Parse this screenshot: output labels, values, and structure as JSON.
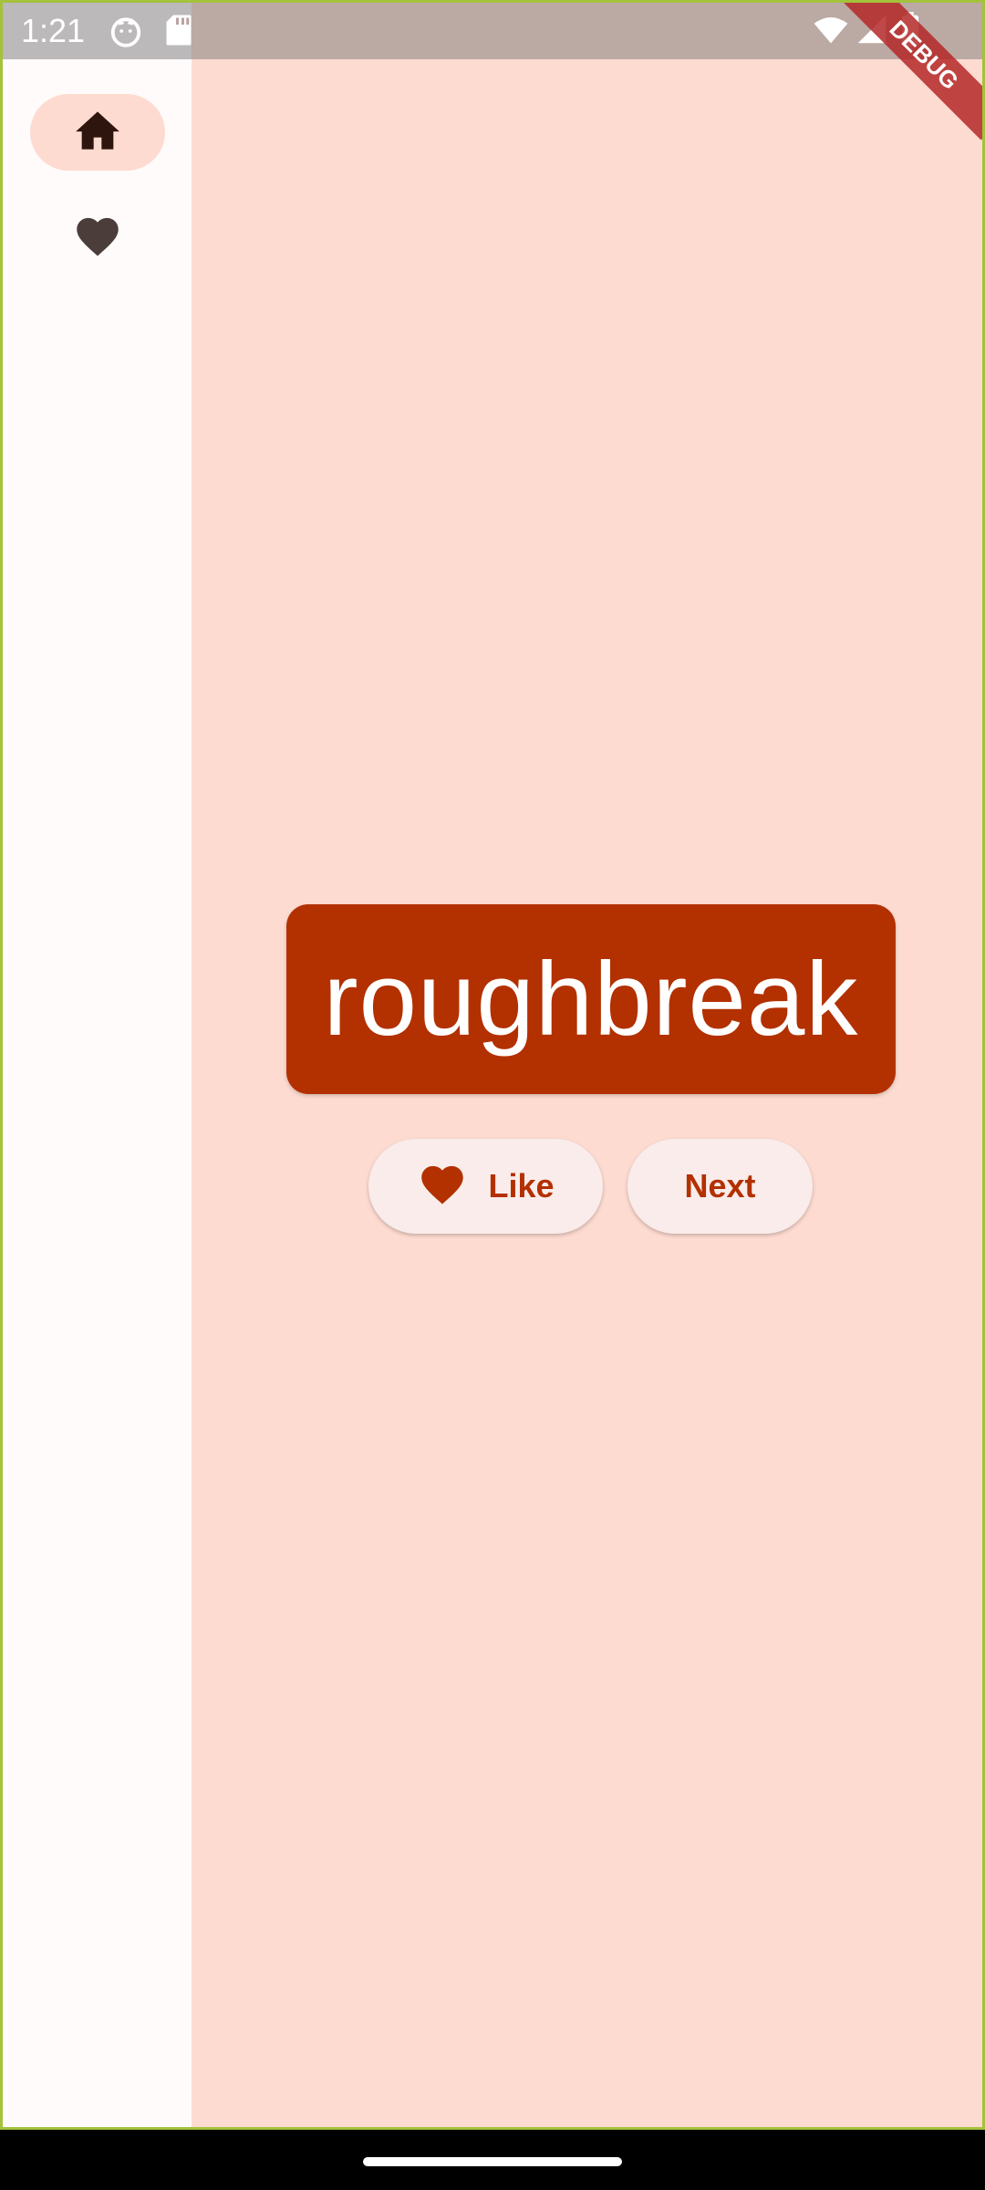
{
  "status_bar": {
    "time": "1:21",
    "icons": [
      "cat-face-icon",
      "sd-card-icon",
      "wifi-icon",
      "cellular-signal-icon",
      "battery-icon"
    ]
  },
  "debug_banner": "DEBUG",
  "navigation_rail": {
    "items": [
      {
        "icon": "home-icon",
        "selected": true
      },
      {
        "icon": "favorite-icon",
        "selected": false
      }
    ]
  },
  "main": {
    "word": "roughbreak",
    "like_label": "Like",
    "next_label": "Next"
  },
  "colors": {
    "primary": "#b33000",
    "content_background": "#fedbd1",
    "rail_background": "#fffbfb",
    "button_background": "#f9ecea"
  }
}
